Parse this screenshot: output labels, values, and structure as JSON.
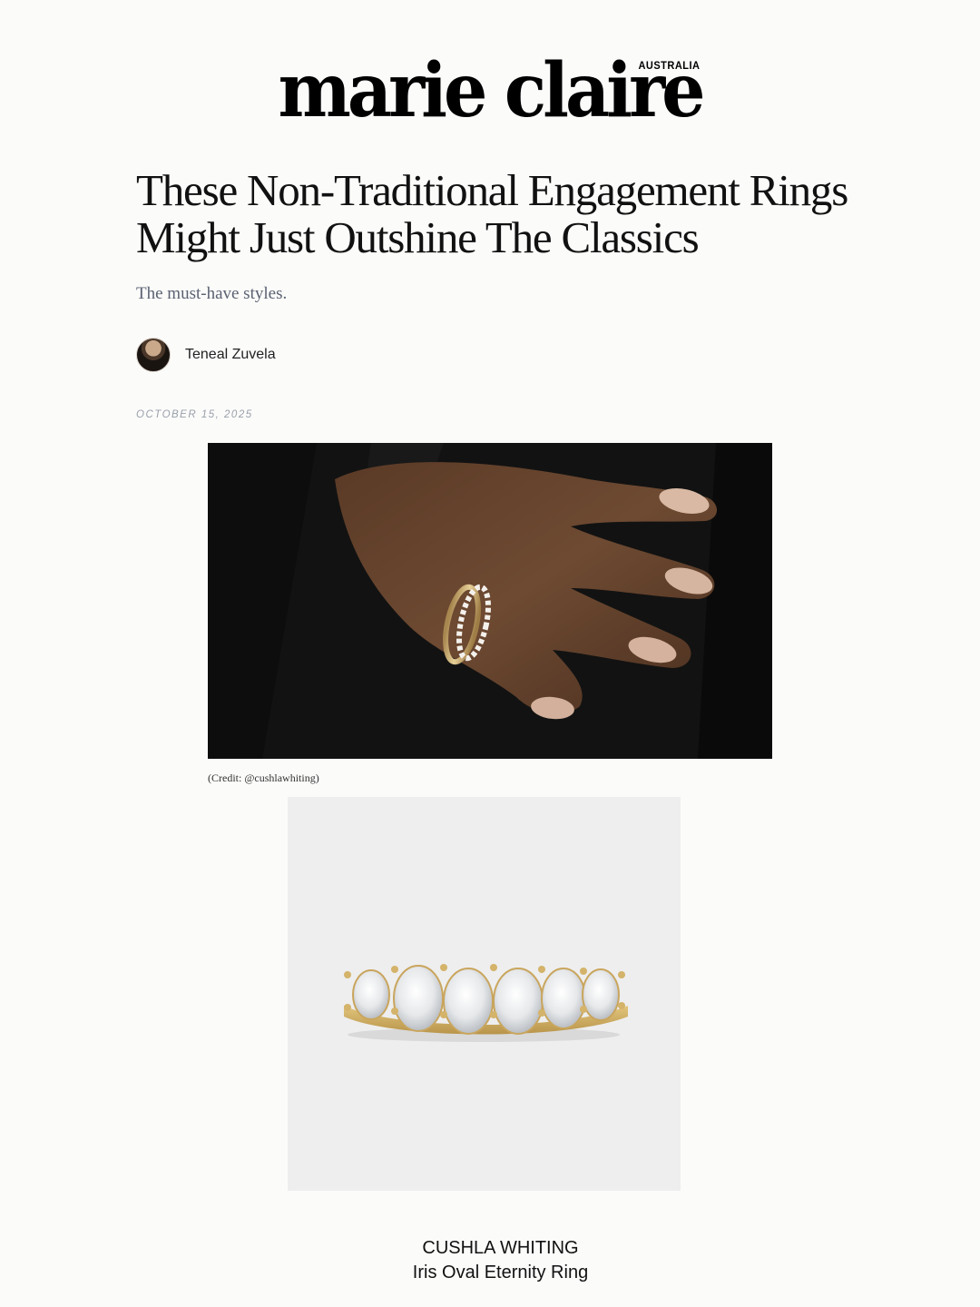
{
  "brand": {
    "logo_text": "marie claire",
    "logo_region": "AUSTRALIA"
  },
  "article": {
    "headline": "These Non-Traditional Engagement Rings Might Just Outshine The Classics",
    "subhead": "The must-have styles.",
    "author": "Teneal Zuvela",
    "date": "OCTOBER 15, 2025",
    "hero_credit": "(Credit: @cushlawhiting)"
  },
  "product": {
    "brand": "CUSHLA WHITING",
    "name": "Iris Oval Eternity Ring"
  }
}
